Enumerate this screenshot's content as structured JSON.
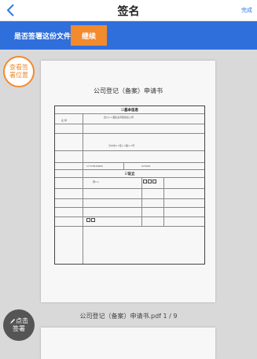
{
  "nav": {
    "title": "签名",
    "done_label": "完成"
  },
  "prompt_bar": {
    "question": "是否签署这份文件",
    "continue_label": "继续"
  },
  "view_position_button": {
    "label_line1": "查看签",
    "label_line2": "署位置"
  },
  "sign_button": {
    "label_line1": "点击",
    "label_line2": "签署"
  },
  "document": {
    "title": "公司登记（备案）申请书",
    "section1_title": "☑基本信息",
    "company_name": "四川××酒店业有限责任公司",
    "address": "泸州市××区××路××号",
    "phone": "17718529860",
    "postcode": "670000",
    "section2_title": "☑设立",
    "legal_rep": "曹××"
  },
  "file_label": "公司登记（备案）申请书.pdf  1 / 9",
  "colors": {
    "accent": "#2f6fdc",
    "orange": "#f28a2e"
  }
}
